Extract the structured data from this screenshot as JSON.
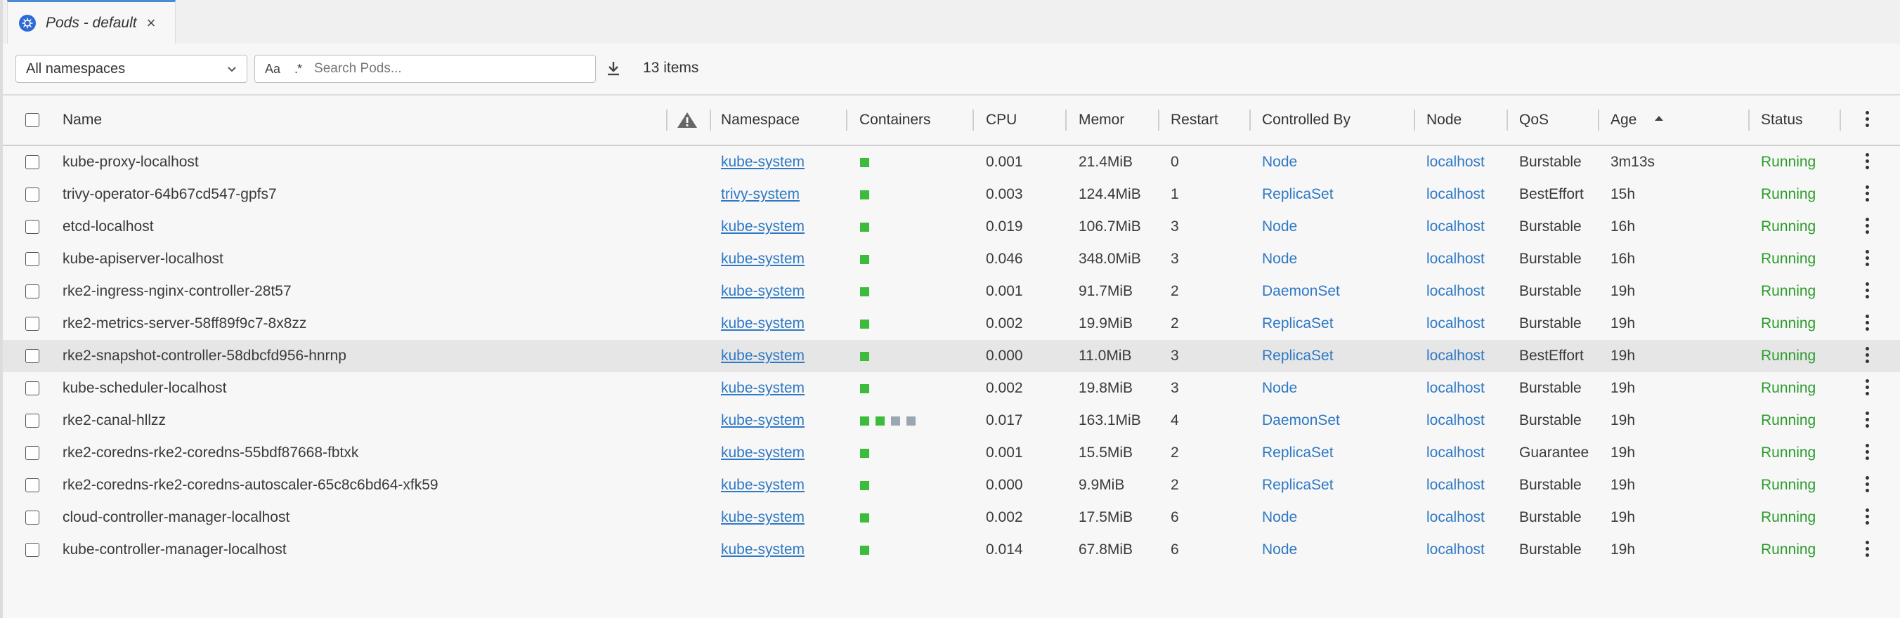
{
  "tab": {
    "title": "Pods - default",
    "close": "×"
  },
  "toolbar": {
    "namespace_select": "All namespaces",
    "search_case": "Aa",
    "search_regex": ".*",
    "search_placeholder": "Search Pods...",
    "item_count": "13 items"
  },
  "columns": {
    "name": "Name",
    "namespace": "Namespace",
    "containers": "Containers",
    "cpu": "CPU",
    "memory": "Memor",
    "restart": "Restart",
    "controlled_by": "Controlled By",
    "node": "Node",
    "qos": "QoS",
    "age": "Age",
    "status": "Status"
  },
  "colors": {
    "container_running": "#3dbb3d",
    "container_terminated": "#9aa7b2",
    "link": "#2f78c4",
    "status_running": "#2b9b2b"
  },
  "pods": [
    {
      "name": "kube-proxy-localhost",
      "namespace": "kube-system",
      "containers": [
        "running"
      ],
      "cpu": "0.001",
      "memory": "21.4MiB",
      "restart": "0",
      "controlled_by": "Node",
      "node": "localhost",
      "qos": "Burstable",
      "age": "3m13s",
      "status": "Running"
    },
    {
      "name": "trivy-operator-64b67cd547-gpfs7",
      "namespace": "trivy-system",
      "containers": [
        "running"
      ],
      "cpu": "0.003",
      "memory": "124.4MiB",
      "restart": "1",
      "controlled_by": "ReplicaSet",
      "node": "localhost",
      "qos": "BestEffort",
      "age": "15h",
      "status": "Running"
    },
    {
      "name": "etcd-localhost",
      "namespace": "kube-system",
      "containers": [
        "running"
      ],
      "cpu": "0.019",
      "memory": "106.7MiB",
      "restart": "3",
      "controlled_by": "Node",
      "node": "localhost",
      "qos": "Burstable",
      "age": "16h",
      "status": "Running"
    },
    {
      "name": "kube-apiserver-localhost",
      "namespace": "kube-system",
      "containers": [
        "running"
      ],
      "cpu": "0.046",
      "memory": "348.0MiB",
      "restart": "3",
      "controlled_by": "Node",
      "node": "localhost",
      "qos": "Burstable",
      "age": "16h",
      "status": "Running"
    },
    {
      "name": "rke2-ingress-nginx-controller-28t57",
      "namespace": "kube-system",
      "containers": [
        "running"
      ],
      "cpu": "0.001",
      "memory": "91.7MiB",
      "restart": "2",
      "controlled_by": "DaemonSet",
      "node": "localhost",
      "qos": "Burstable",
      "age": "19h",
      "status": "Running"
    },
    {
      "name": "rke2-metrics-server-58ff89f9c7-8x8zz",
      "namespace": "kube-system",
      "containers": [
        "running"
      ],
      "cpu": "0.002",
      "memory": "19.9MiB",
      "restart": "2",
      "controlled_by": "ReplicaSet",
      "node": "localhost",
      "qos": "Burstable",
      "age": "19h",
      "status": "Running"
    },
    {
      "name": "rke2-snapshot-controller-58dbcfd956-hnrnp",
      "namespace": "kube-system",
      "containers": [
        "running"
      ],
      "cpu": "0.000",
      "memory": "11.0MiB",
      "restart": "3",
      "controlled_by": "ReplicaSet",
      "node": "localhost",
      "qos": "BestEffort",
      "age": "19h",
      "status": "Running",
      "selected": true
    },
    {
      "name": "kube-scheduler-localhost",
      "namespace": "kube-system",
      "containers": [
        "running"
      ],
      "cpu": "0.002",
      "memory": "19.8MiB",
      "restart": "3",
      "controlled_by": "Node",
      "node": "localhost",
      "qos": "Burstable",
      "age": "19h",
      "status": "Running"
    },
    {
      "name": "rke2-canal-hllzz",
      "namespace": "kube-system",
      "containers": [
        "running",
        "running",
        "terminated",
        "terminated"
      ],
      "cpu": "0.017",
      "memory": "163.1MiB",
      "restart": "4",
      "controlled_by": "DaemonSet",
      "node": "localhost",
      "qos": "Burstable",
      "age": "19h",
      "status": "Running"
    },
    {
      "name": "rke2-coredns-rke2-coredns-55bdf87668-fbtxk",
      "namespace": "kube-system",
      "containers": [
        "running"
      ],
      "cpu": "0.001",
      "memory": "15.5MiB",
      "restart": "2",
      "controlled_by": "ReplicaSet",
      "node": "localhost",
      "qos": "Guarantee",
      "age": "19h",
      "status": "Running"
    },
    {
      "name": "rke2-coredns-rke2-coredns-autoscaler-65c8c6bd64-xfk59",
      "namespace": "kube-system",
      "containers": [
        "running"
      ],
      "cpu": "0.000",
      "memory": "9.9MiB",
      "restart": "2",
      "controlled_by": "ReplicaSet",
      "node": "localhost",
      "qos": "Burstable",
      "age": "19h",
      "status": "Running"
    },
    {
      "name": "cloud-controller-manager-localhost",
      "namespace": "kube-system",
      "containers": [
        "running"
      ],
      "cpu": "0.002",
      "memory": "17.5MiB",
      "restart": "6",
      "controlled_by": "Node",
      "node": "localhost",
      "qos": "Burstable",
      "age": "19h",
      "status": "Running"
    },
    {
      "name": "kube-controller-manager-localhost",
      "namespace": "kube-system",
      "containers": [
        "running"
      ],
      "cpu": "0.014",
      "memory": "67.8MiB",
      "restart": "6",
      "controlled_by": "Node",
      "node": "localhost",
      "qos": "Burstable",
      "age": "19h",
      "status": "Running"
    }
  ]
}
